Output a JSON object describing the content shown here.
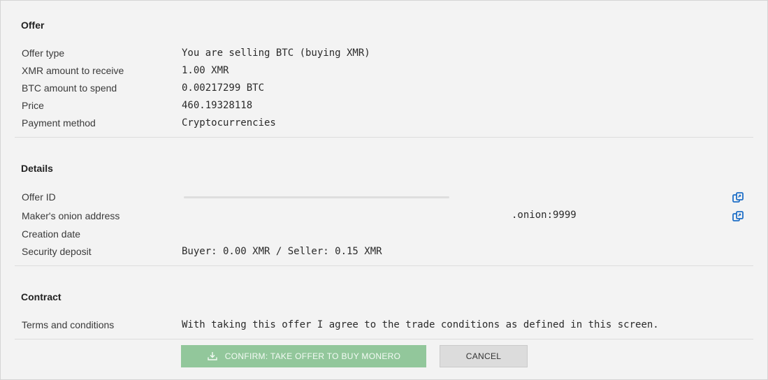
{
  "offer": {
    "title": "Offer",
    "rows": [
      {
        "label": "Offer type",
        "value": "You are selling BTC (buying XMR)"
      },
      {
        "label": "XMR amount to receive",
        "value": "1.00 XMR"
      },
      {
        "label": "BTC amount to spend",
        "value": "0.00217299 BTC"
      },
      {
        "label": "Price",
        "value": "460.19328118"
      },
      {
        "label": "Payment method",
        "value": "Cryptocurrencies"
      }
    ]
  },
  "details": {
    "title": "Details",
    "offer_id_label": "Offer ID",
    "onion_label": "Maker's onion address",
    "onion_value": ".onion:9999",
    "creation_label": "Creation date",
    "deposit_label": "Security deposit",
    "deposit_value": "Buyer: 0.00 XMR / Seller: 0.15 XMR"
  },
  "contract": {
    "title": "Contract",
    "terms_label": "Terms and conditions",
    "terms_value": "With taking this offer I agree to the trade conditions as defined in this screen."
  },
  "actions": {
    "confirm_label": "CONFIRM: TAKE OFFER TO BUY MONERO",
    "cancel_label": "CANCEL"
  },
  "icons": {
    "copy": "copy-icon",
    "download": "download-icon"
  },
  "colors": {
    "confirm_bg": "#92c79b",
    "accent_blue": "#1e6fc7",
    "cancel_bg": "#dcdcdc"
  }
}
